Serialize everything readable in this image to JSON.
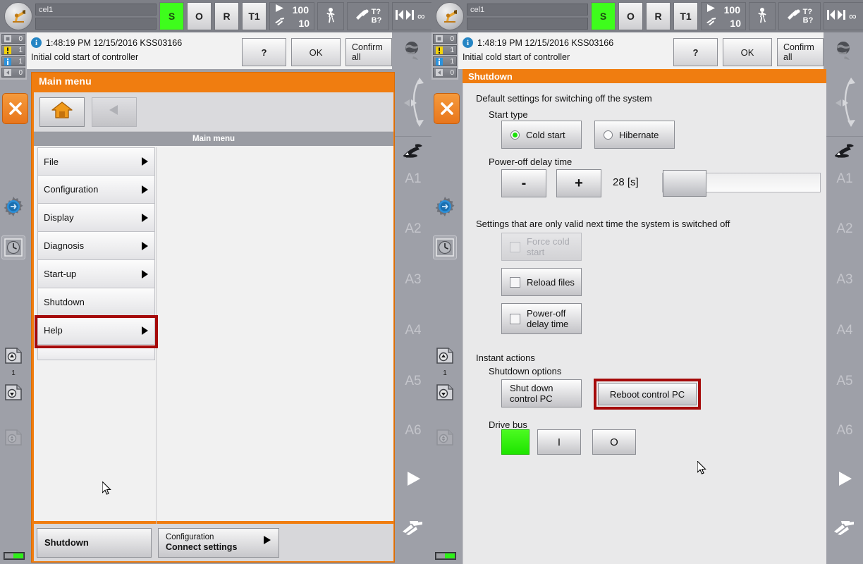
{
  "topbar": {
    "robot_icon": "kuka-robot-icon",
    "name_field_value": "cel1",
    "name_field2_value": "",
    "status_s": "S",
    "status_o": "O",
    "status_r": "R",
    "mode": "T1",
    "override_program": "100",
    "override_jog": "10",
    "walk_icon": "pedestrian-icon",
    "tool_query": "T?",
    "base_query": "B?",
    "incremental_icon": "incremental-jog-icon",
    "incremental_value": "∞"
  },
  "message_counters": [
    {
      "icon": "ack-message-icon",
      "count": "0"
    },
    {
      "icon": "warning-message-icon",
      "count": "1"
    },
    {
      "icon": "info-message-icon",
      "count": "1"
    },
    {
      "icon": "wait-message-icon",
      "count": "0"
    }
  ],
  "message": {
    "timestamp": "1:48:19 PM 12/15/2016 KSS03166",
    "text": "Initial cold start of controller",
    "help_label": "?",
    "ok_label": "OK",
    "confirm_all_label": "Confirm all"
  },
  "right_rail": {
    "axis_labels": [
      "A1",
      "A2",
      "A3",
      "A4",
      "A5",
      "A6"
    ],
    "jog_icon": "jog-coordinate-icon",
    "play_icon": "play-icon",
    "hand_icon": "hand-jog-icon"
  },
  "left_rail": {
    "stop_icon": "close-x-icon",
    "settings_icon": "settings-gear-icon",
    "clock_icon": "clock-icon",
    "file_up_icon": "program-up-icon",
    "file_up_count": "1",
    "file_down_icon": "program-down-icon",
    "file_disabled_icon": "program-disabled-icon"
  },
  "left_pad": {
    "panel_title": "Main menu",
    "home_icon": "home-icon",
    "back_icon": "back-arrow-icon",
    "menu_header": "Main menu",
    "menu_items": [
      {
        "label": "File",
        "has_arrow": true,
        "selected": false
      },
      {
        "label": "Configuration",
        "has_arrow": true,
        "selected": false
      },
      {
        "label": "Display",
        "has_arrow": true,
        "selected": false
      },
      {
        "label": "Diagnosis",
        "has_arrow": true,
        "selected": false
      },
      {
        "label": "Start-up",
        "has_arrow": true,
        "selected": false
      },
      {
        "label": "Shutdown",
        "has_arrow": false,
        "selected": true
      },
      {
        "label": "Help",
        "has_arrow": true,
        "selected": false
      }
    ],
    "softkeys": {
      "shutdown_label": "Shutdown",
      "config_sub": "Configuration",
      "config_main": "Connect settings"
    }
  },
  "right_pad": {
    "panel_title": "Shutdown",
    "default_settings_label": "Default settings for switching off the system",
    "start_type_label": "Start type",
    "start_type_options": [
      {
        "label": "Cold start",
        "selected": true
      },
      {
        "label": "Hibernate",
        "selected": false
      }
    ],
    "power_off_delay_label": "Power-off delay time",
    "minus_label": "-",
    "plus_label": "+",
    "delay_value": "28 [s]",
    "next_time_label": "Settings that are only valid next time the system is switched off",
    "checkboxes": [
      {
        "label": "Force cold start",
        "checked": false,
        "disabled": true
      },
      {
        "label": "Reload files",
        "checked": false,
        "disabled": false
      },
      {
        "label": "Power-off delay time",
        "checked": false,
        "disabled": false
      }
    ],
    "instant_actions_label": "Instant actions",
    "shutdown_options_label": "Shutdown options",
    "shutdown_buttons": [
      {
        "label": "Shut down control PC",
        "highlighted": false
      },
      {
        "label": "Reboot control PC",
        "highlighted": true
      }
    ],
    "drive_bus_label": "Drive bus",
    "drive_bus_on_label": "I",
    "drive_bus_off_label": "O"
  },
  "colors": {
    "accent_orange": "#f07d10",
    "highlight_red": "#a50a0a",
    "status_green": "#3efd1c",
    "chrome_gray": "#9ea0a8"
  }
}
